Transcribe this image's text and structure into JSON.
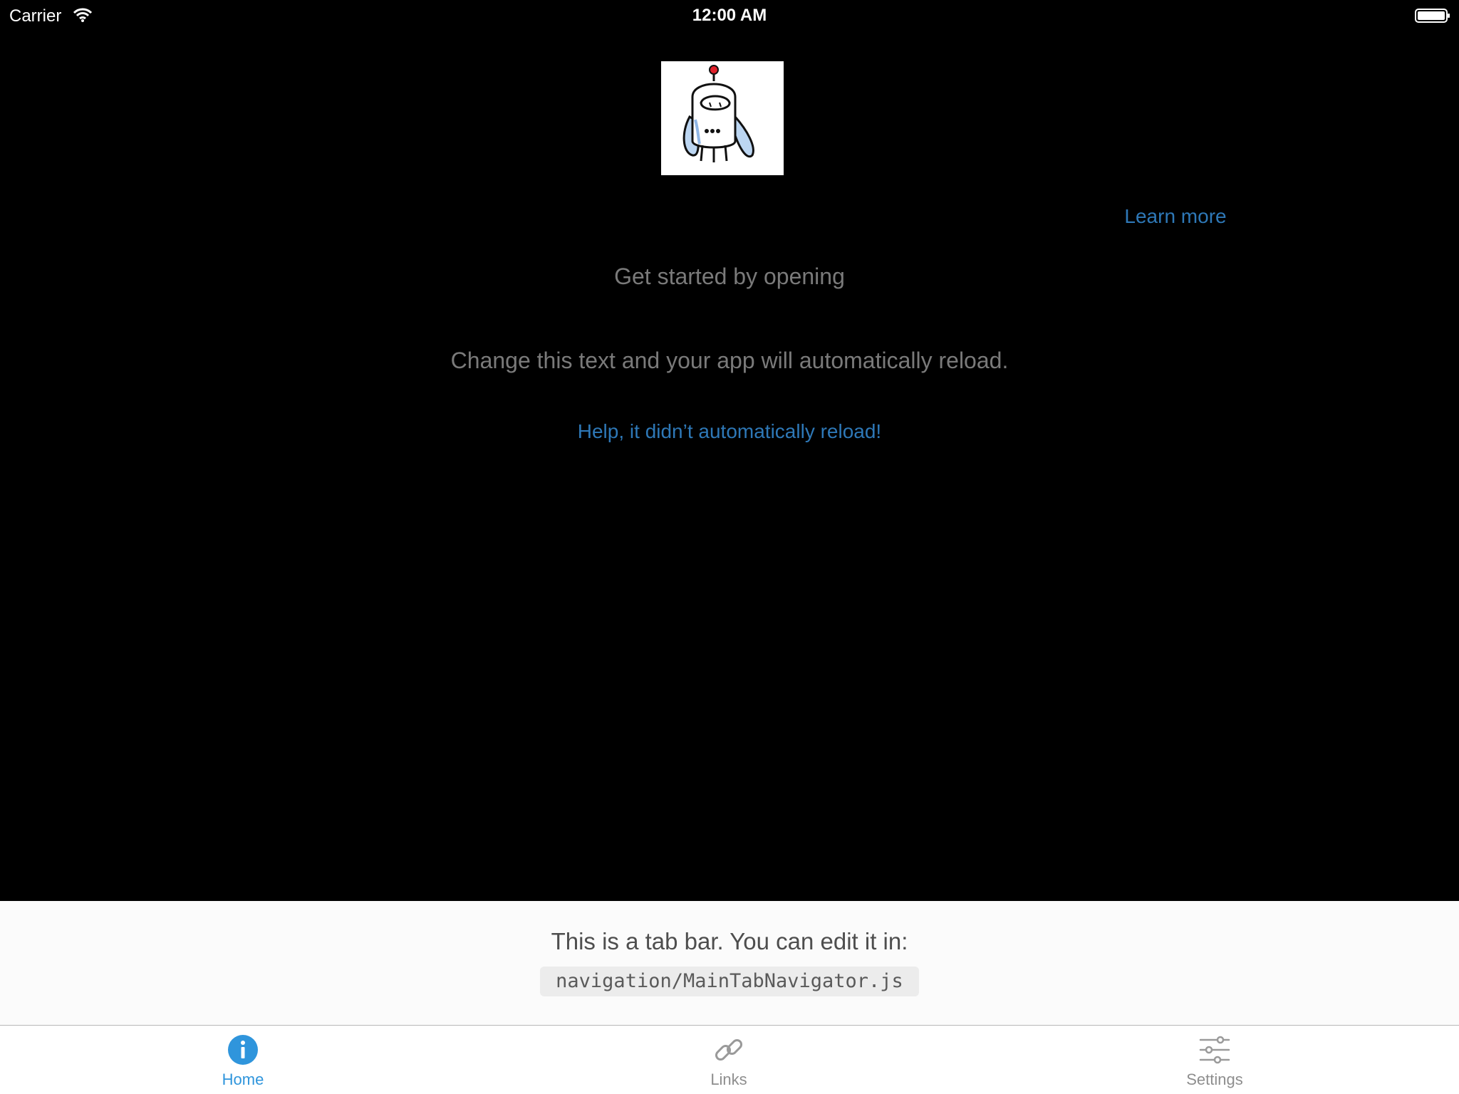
{
  "status_bar": {
    "carrier": "Carrier",
    "time": "12:00 AM",
    "icons": [
      "wifi-icon",
      "battery-icon"
    ]
  },
  "main": {
    "logo": "robot-logo",
    "learn_more": "Learn more",
    "get_started": "Get started by opening",
    "change_text": "Change this text and your app will automatically reload.",
    "help_link": "Help, it didn’t automatically reload!"
  },
  "info_panel": {
    "text": "This is a tab bar. You can edit it in:",
    "code_path": "navigation/MainTabNavigator.js"
  },
  "tabs": [
    {
      "label": "Home",
      "icon": "info-icon",
      "active": true
    },
    {
      "label": "Links",
      "icon": "link-icon",
      "active": false
    },
    {
      "label": "Settings",
      "icon": "sliders-icon",
      "active": false
    }
  ],
  "colors": {
    "background": "#000000",
    "link": "#2e78b7",
    "muted_text": "#7a7a7a",
    "tab_active": "#2f95dc",
    "tab_inactive": "#8e8e8e",
    "panel_bg": "#fbfbfb"
  }
}
